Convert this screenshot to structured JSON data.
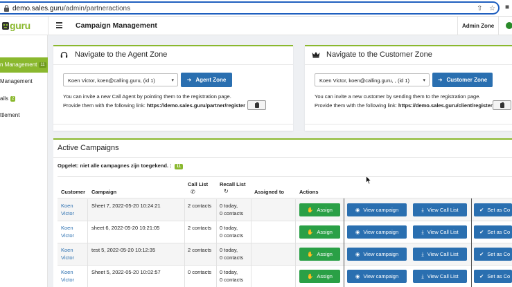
{
  "browser": {
    "url_host": "demo.sales.guru",
    "url_path": "/admin/partneractions"
  },
  "header": {
    "logo_text": "guru",
    "page_title": "Campaign Management",
    "admin_zone": "Admin Zone"
  },
  "sidebar": {
    "items": [
      {
        "label": "n Management",
        "badge": "11",
        "active": true
      },
      {
        "label": "Management",
        "badge": "",
        "active": false
      },
      {
        "label": "ails",
        "badge": "2",
        "active": false
      },
      {
        "label": "ttlement",
        "badge": "",
        "active": false
      }
    ]
  },
  "agent_zone": {
    "title": "Navigate to the Agent Zone",
    "select_value": "Koen Victor, koen@calling.guru, (id 1)",
    "button": "Agent Zone",
    "line1": "You can invite a new Call Agent by pointing them to the registration page.",
    "line2_prefix": "Provide them with the following link: ",
    "link": "https://demo.sales.guru/partner/register"
  },
  "customer_zone": {
    "title": "Navigate to the Customer Zone",
    "select_value": "Koen Victor, koen@calling.guru, , (id 1)",
    "button": "Customer Zone",
    "line1": "You can invite a new customer by sending them to the registration page.",
    "line2_prefix": "Provide them with the following link: ",
    "link": "https://demo.sales.guru/client/register"
  },
  "campaigns": {
    "title": "Active Campaigns",
    "notice": "Opgelet: niet alle campagnes zijn toegekend. :",
    "notice_badge": "11",
    "columns": {
      "customer": "Customer",
      "campaign": "Campaign",
      "call_list": "Call List",
      "recall_list": "Recall List",
      "assigned_to": "Assigned to",
      "actions": "Actions"
    },
    "buttons": {
      "assign": "Assign",
      "view_campaign": "View campaign",
      "view_call_list": "View Call List",
      "set_as": "Set as Co"
    },
    "rows": [
      {
        "customer_first": "Koen",
        "customer_last": "Victor",
        "campaign": "Sheet 7, 2022-05-20 10:24:21",
        "call_list": "2 contacts",
        "recall_today": "0 today,",
        "recall_contacts": "0 contacts"
      },
      {
        "customer_first": "Koen",
        "customer_last": "Victor",
        "campaign": "sheet 6, 2022-05-20 10:21:05",
        "call_list": "2 contacts",
        "recall_today": "0 today,",
        "recall_contacts": "0 contacts"
      },
      {
        "customer_first": "Koen",
        "customer_last": "Victor",
        "campaign": "test 5, 2022-05-20 10:12:35",
        "call_list": "2 contacts",
        "recall_today": "0 today,",
        "recall_contacts": "0 contacts"
      },
      {
        "customer_first": "Koen",
        "customer_last": "Victor",
        "campaign": "Sheet 5, 2022-05-20 10:02:57",
        "call_list": "0 contacts",
        "recall_today": "0 today,",
        "recall_contacts": "0 contacts"
      }
    ]
  },
  "colors": {
    "brand_green": "#8ab82e",
    "button_blue": "#2a6fb0",
    "button_green": "#2aa046"
  }
}
